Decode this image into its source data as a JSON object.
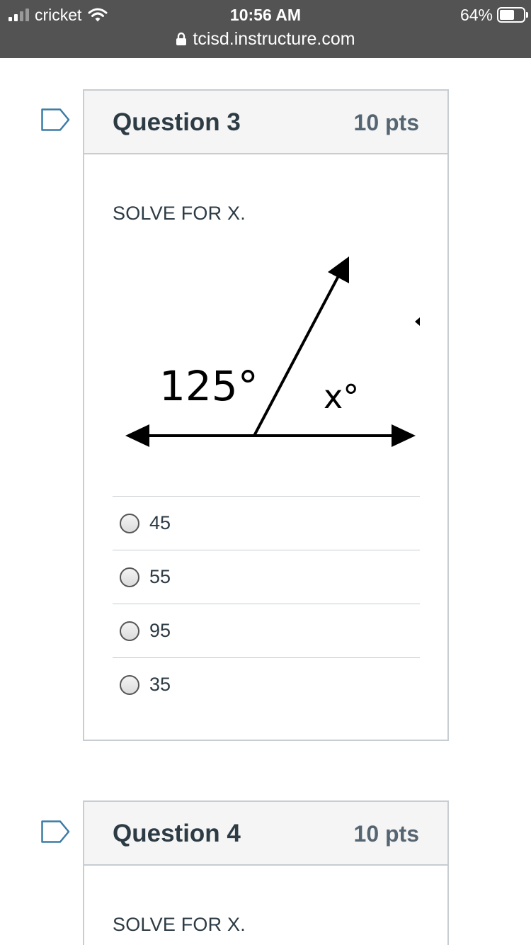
{
  "status_bar": {
    "carrier": "cricket",
    "time": "10:56 AM",
    "battery": "64%",
    "battery_level": 0.64,
    "url": "tcisd.instructure.com"
  },
  "questions": [
    {
      "title": "Question 3",
      "points": "10 pts",
      "prompt": "SOLVE FOR X.",
      "figure": {
        "angle_label": "125°",
        "unknown_label": "x°"
      },
      "answers": [
        "45",
        "55",
        "95",
        "35"
      ]
    },
    {
      "title": "Question 4",
      "points": "10 pts",
      "prompt": "SOLVE FOR X."
    }
  ],
  "colors": {
    "status_bar_bg": "#535353",
    "card_border": "#c7cdd1",
    "header_bg": "#f5f5f5",
    "text_primary": "#2d3b45",
    "flag_blue": "#3c7ca4"
  }
}
